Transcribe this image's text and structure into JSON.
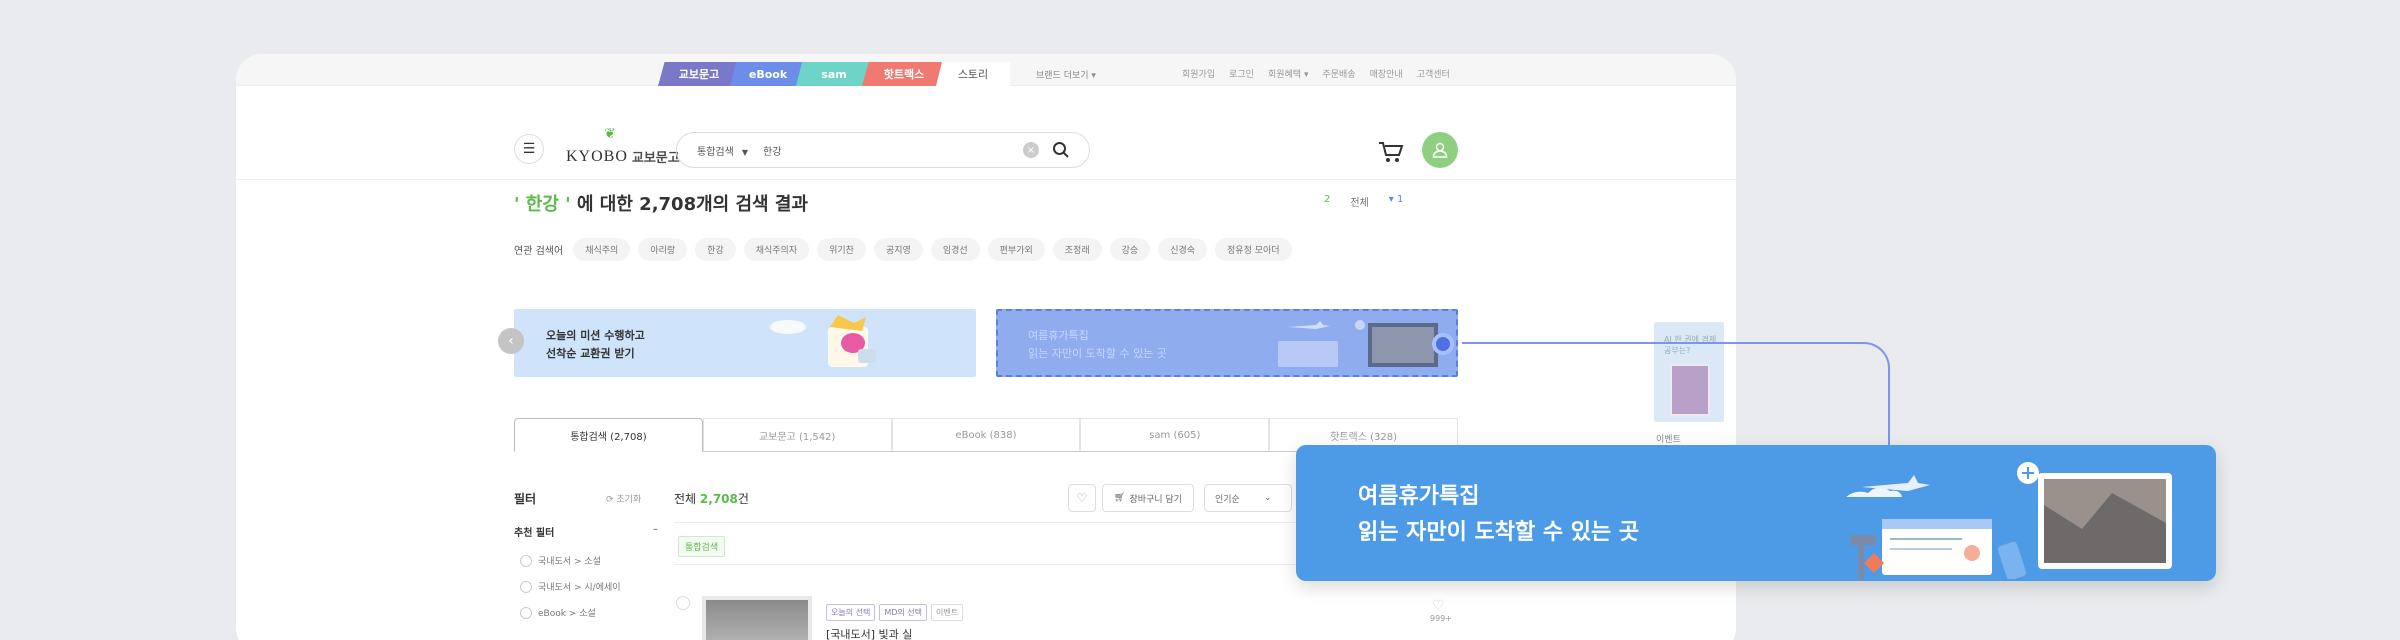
{
  "channels": [
    {
      "label": "교보문고",
      "color": "#7a78c8"
    },
    {
      "label": "eBook",
      "color": "#6c8ee8"
    },
    {
      "label": "sam",
      "color": "#6fd4c8"
    },
    {
      "label": "핫트랙스",
      "color": "#f07a72"
    },
    {
      "label": "스토리"
    }
  ],
  "brand_more": "브랜드 더보기 ▾",
  "util_links": [
    "회원가입",
    "로그인",
    "회원혜택 ▾",
    "주문배송",
    "매장안내",
    "고객센터"
  ],
  "logo": {
    "en": "KYOBO",
    "ko": "교보문고"
  },
  "search": {
    "scope": "통합검색",
    "query": "한강"
  },
  "result": {
    "kw_open": "' 한강 '",
    "rest": " 에 대한 2,708개의 검색 결과"
  },
  "page_info": {
    "current": "2",
    "label": "전체",
    "next": "▾ 1"
  },
  "related": {
    "label": "연관 검색어",
    "terms": [
      "채식주의",
      "아리랑",
      "한강",
      "채식주의자",
      "위기찬",
      "공지영",
      "임경선",
      "편부가외",
      "조정래",
      "강승",
      "신경숙",
      "정유정 모아더"
    ]
  },
  "banners": [
    {
      "line1": "오늘의 미션 수행하고",
      "line2": "선착순 교환권 받기"
    },
    {
      "line1": "여름휴가특집",
      "line2": "읽는 자만이 도착할 수 있는 곳"
    }
  ],
  "result_tabs": [
    "통합검색 (2,708)",
    "교보문고 (1,542)",
    "eBook (838)",
    "sam (605)",
    "핫트랙스 (328)"
  ],
  "filter": {
    "title": "필터",
    "reset": "⟳ 초기화",
    "recommended": "추천 필터",
    "items": [
      "국내도서 > 소설",
      "국내도서 > 시/에세이",
      "eBook > 소설"
    ]
  },
  "list": {
    "total_prefix": "전체 ",
    "total_count": "2,708",
    "total_suffix": "건",
    "cart_label": "장바구니 담기",
    "sort_label": "인기순",
    "scope_tag": "통합검색"
  },
  "book": {
    "badges": [
      "오늘의 선택",
      "MD의 선택",
      "이벤트"
    ],
    "title": "[국내도서] 빛과 실",
    "likes": "999+"
  },
  "side_ad": {
    "text": "AI 한 권에 경제 공부는?",
    "label": "이벤트"
  },
  "popup": {
    "line1": "여름휴가특집",
    "line2": "읽는 자만이 도착할 수 있는 곳"
  }
}
